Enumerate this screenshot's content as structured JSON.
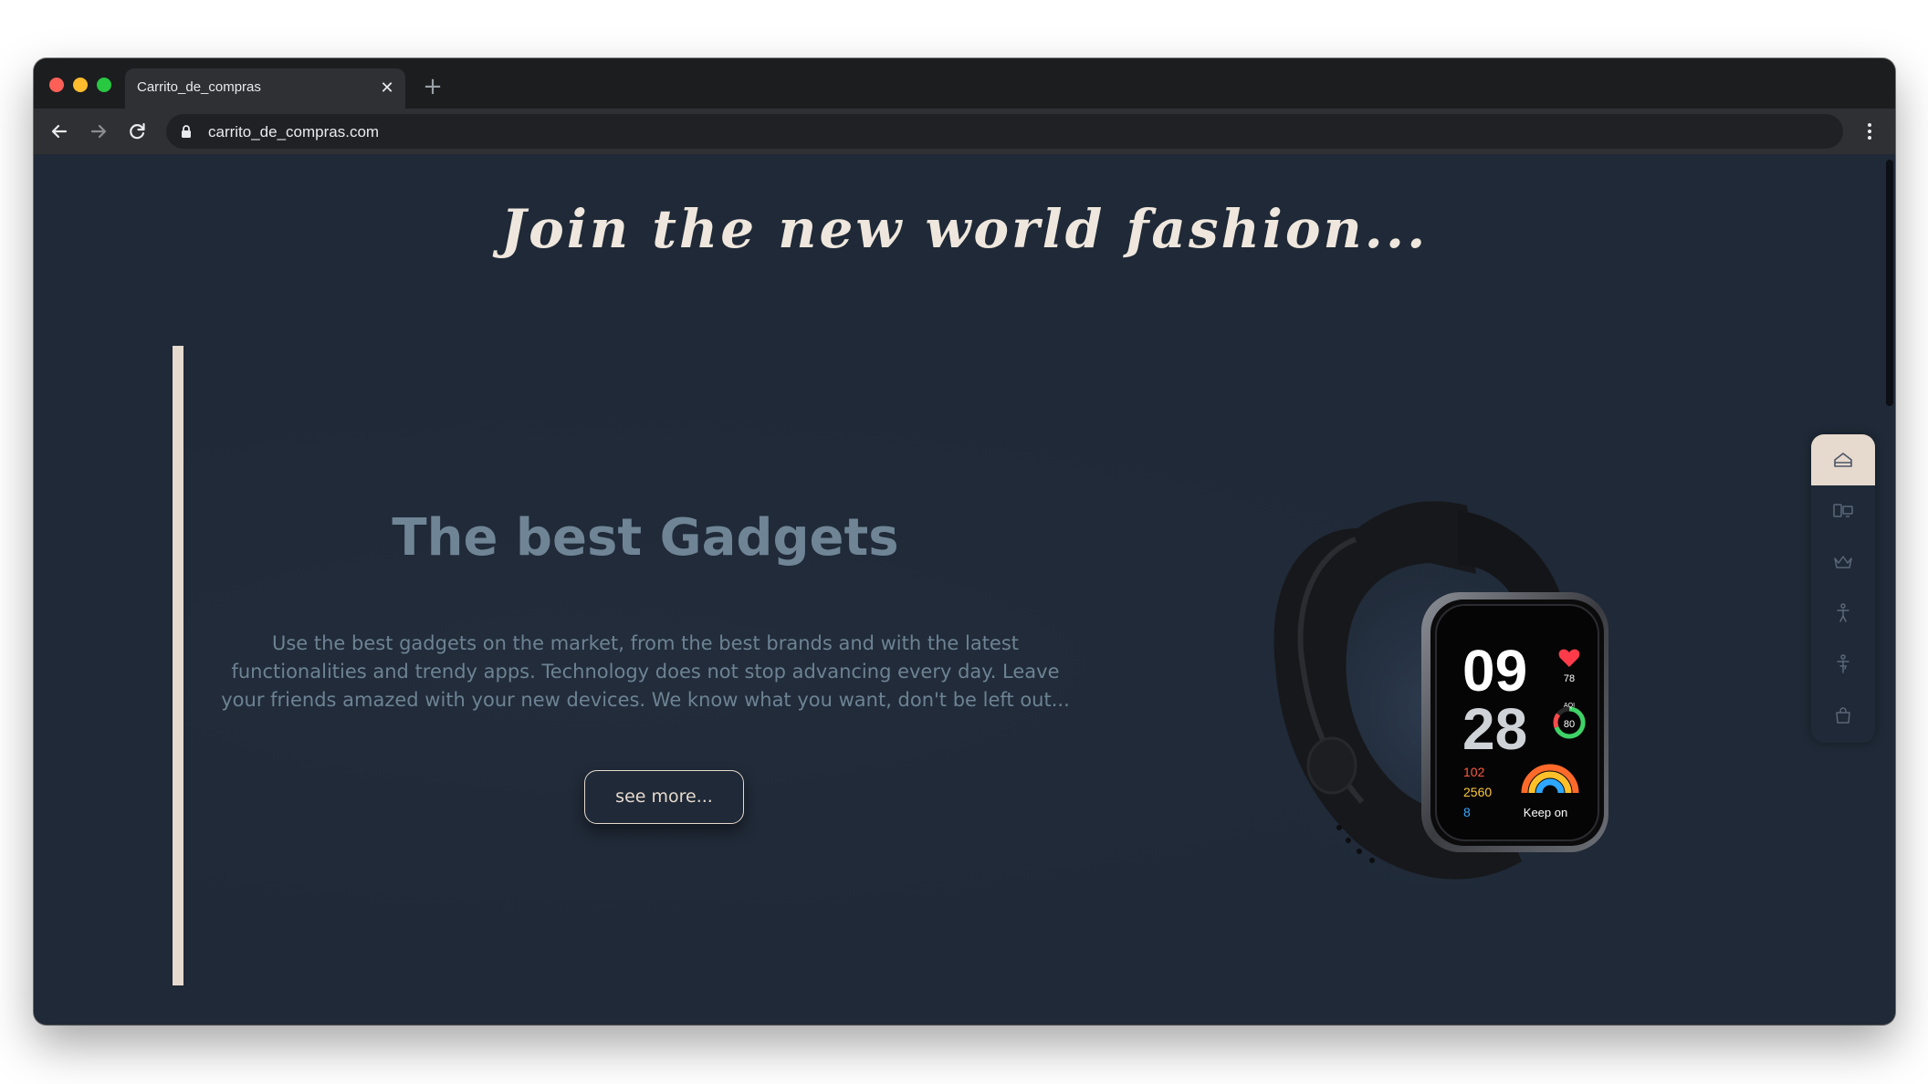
{
  "browser": {
    "tab_title": "Carrito_de_compras",
    "tab_close_icon": "close-icon",
    "new_tab_icon": "plus-icon",
    "url": "carrito_de_compras.com",
    "nav_icons": [
      "arrow-left-icon",
      "arrow-right-icon",
      "reload-icon",
      "lock-icon",
      "more-vertical-icon"
    ]
  },
  "page": {
    "headline": "Join the new world fashion...",
    "hero": {
      "title": "The best Gadgets",
      "description": "Use the best gadgets on the market, from the best brands and with the latest functionalities and trendy apps. Technology does not stop advancing every day. Leave your friends amazed with your new devices. We know what you want, don't be left out...",
      "cta_label": "see more...",
      "image": {
        "subject": "smartwatch",
        "screen": {
          "hour": "09",
          "minute": "28",
          "heart_rate": "78",
          "aqi_label": "AQI",
          "aqi_value": "80",
          "stat_1": "102",
          "stat_2": "2560",
          "stat_3": "8",
          "caption": "Keep on"
        }
      }
    },
    "side_nav": {
      "items": [
        "home-icon",
        "devices-icon",
        "crown-icon",
        "man-icon",
        "woman-icon",
        "shopping-bag-icon"
      ],
      "active_index": 0
    }
  },
  "colors": {
    "page_background": "#1f2937",
    "accent": "#e6d9cd",
    "muted_text": "#6f8596"
  }
}
